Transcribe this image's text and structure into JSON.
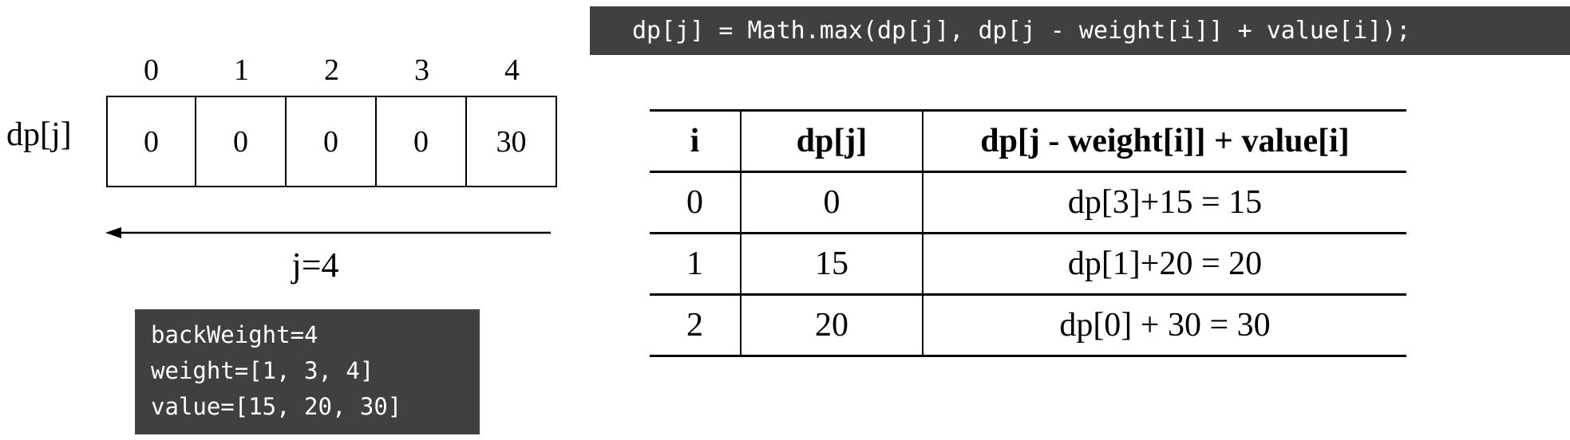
{
  "code_line": "dp[j] = Math.max(dp[j], dp[j - weight[i]] + value[i]);",
  "dp_label": "dp[j]",
  "indices": [
    "0",
    "1",
    "2",
    "3",
    "4"
  ],
  "dp_values": [
    "0",
    "0",
    "0",
    "0",
    "30"
  ],
  "j_label": "j=4",
  "info": {
    "line1": "backWeight=4",
    "line2": "weight=[1, 3, 4]",
    "line3": "value=[15, 20, 30]"
  },
  "table": {
    "headers": [
      "i",
      "dp[j]",
      "dp[j - weight[i]] + value[i]"
    ],
    "rows": [
      [
        "0",
        "0",
        "dp[3]+15 = 15"
      ],
      [
        "1",
        "15",
        "dp[1]+20 = 20"
      ],
      [
        "2",
        "20",
        "dp[0] + 30 = 30"
      ]
    ]
  },
  "colors": {
    "code_bg": "#404040",
    "code_fg": "#ffffff"
  },
  "icons": {
    "arrow": "left-arrow-icon"
  }
}
